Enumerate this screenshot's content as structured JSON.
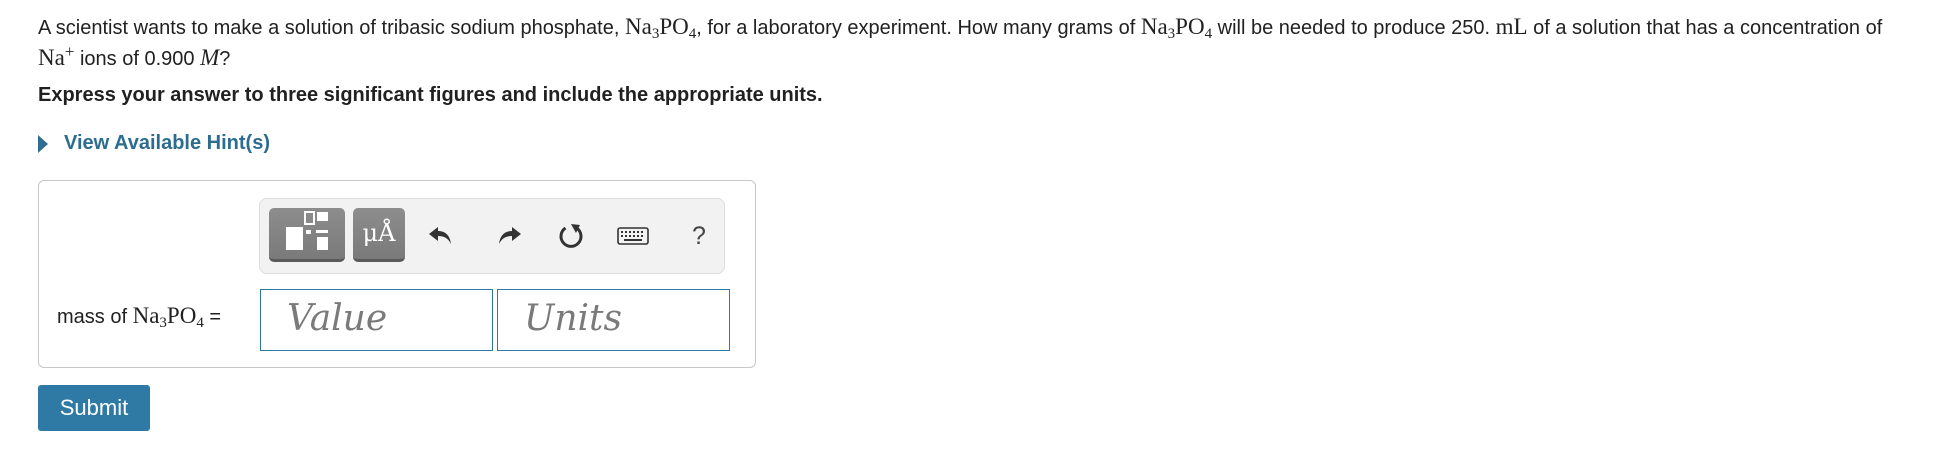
{
  "question": {
    "part1": "A scientist wants to make a solution of tribasic sodium phosphate, ",
    "formula_na": "Na",
    "formula_3": "3",
    "formula_po": "PO",
    "formula_4": "4",
    "part2": ", for a laboratory experiment. How many grams of ",
    "part3": " will be needed to produce 250. ",
    "unit_ml": "mL",
    "part4": " of a solution that has a concentration of ",
    "ion": "Na",
    "ion_charge": "+",
    "part5": " ions of 0.900 ",
    "molar": "M",
    "part6": "?"
  },
  "instruction": "Express your answer to three significant figures and include the appropriate units.",
  "hint": {
    "label": "View Available Hint(s)"
  },
  "toolbar": {
    "symbols_label": "μÅ",
    "help_label": "?",
    "icons": [
      "templates-icon",
      "symbols-icon",
      "undo-icon",
      "redo-icon",
      "reset-icon",
      "keyboard-icon",
      "help-icon"
    ]
  },
  "answer": {
    "label_prefix": "mass of ",
    "label_suffix": " =",
    "value_placeholder": "Value",
    "units_placeholder": "Units"
  },
  "submit_label": "Submit",
  "colors": {
    "accent": "#2f7aa5",
    "hint": "#2c6d8f",
    "toolbar_button": "#838383"
  }
}
